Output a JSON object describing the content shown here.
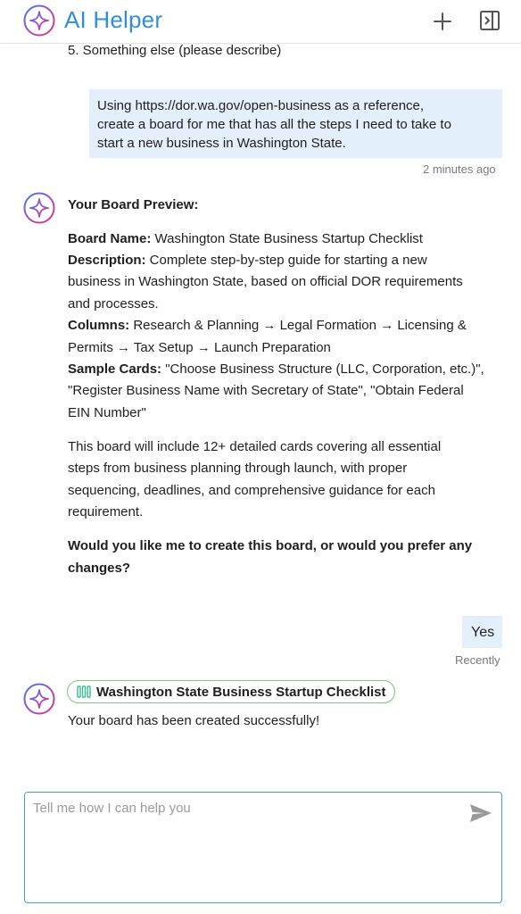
{
  "header": {
    "title": "AI Helper",
    "new_chat_icon": "plus-icon",
    "panel_icon": "side-panel-icon",
    "logo_icon": "sparkle-logo-icon"
  },
  "messages": {
    "prev_item": "5. Something else (please describe)",
    "user_request": {
      "lines": [
        "Using https://dor.wa.gov/open-business as a reference,",
        "create a board for me that has all the steps I need to take to",
        "start a new business in Washington State."
      ],
      "time": "2 minutes ago"
    },
    "preview": {
      "heading": "Your Board Preview:",
      "board_name_label": "Board Name:",
      "board_name_value": " Washington State Business Startup Checklist",
      "description_label": "Description:",
      "description_line1": " Complete step-by-step guide for starting a new",
      "description_line2": "business in Washington State, based on official DOR requirements",
      "description_line3": "and processes.",
      "columns_label": "Columns:",
      "columns_line1": " Research & Planning → Legal Formation → Licensing &",
      "columns_line2": "Permits → Tax Setup → Launch Preparation",
      "sample_label": "Sample Cards:",
      "sample_line1": " \"Choose Business Structure (LLC, Corporation, etc.)\",",
      "sample_line2": "\"Register Business Name with Secretary of State\", \"Obtain Federal",
      "sample_line3": "EIN Number\"",
      "para_lines": [
        "This board will include 12+ detailed cards covering all essential",
        "steps from business planning through launch, with proper",
        "sequencing, deadlines, and comprehensive guidance for each",
        "requirement."
      ],
      "question_lines": [
        "Would you like me to create this board, or would you prefer any",
        "changes?"
      ]
    },
    "user_yes": {
      "text": "Yes",
      "time": "Recently"
    },
    "result": {
      "chip_label": "Washington State Business Startup Checklist",
      "chip_icon": "board-columns-icon",
      "text": "Your board has been created successfully!"
    }
  },
  "composer": {
    "placeholder": "Tell me how I can help you",
    "send_icon": "send-icon"
  },
  "colors": {
    "brand_blue": "#2f8fd8",
    "user_bubble": "#e3effb",
    "chip_border": "#7cc67a",
    "chip_icon": "#3bbf95"
  }
}
